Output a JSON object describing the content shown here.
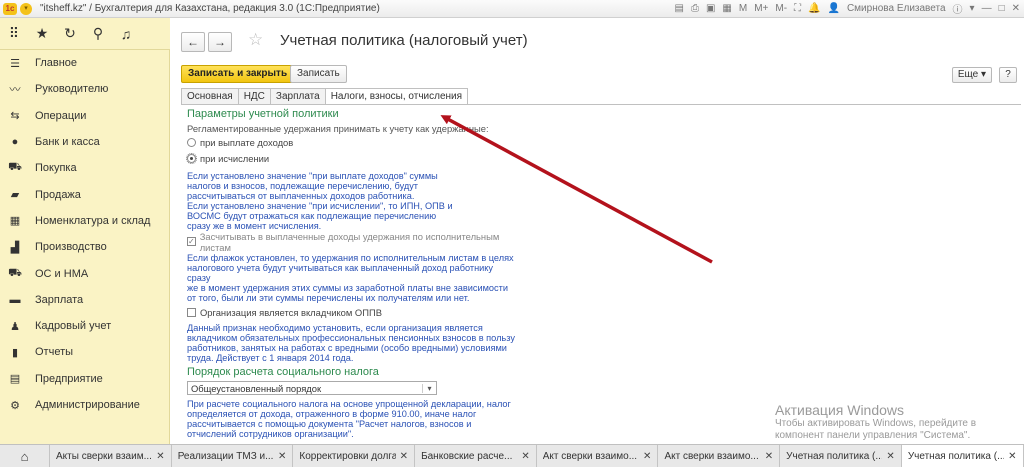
{
  "window": {
    "title": "\"itsheff.kz\" / Бухгалтерия для Казахстана, редакция 3.0  (1С:Предприятие)",
    "user": "Смирнова Елизавета"
  },
  "iconbar": [
    "apps-icon",
    "star-icon",
    "history-icon",
    "search-icon",
    "bell-icon"
  ],
  "sidebar": {
    "items": [
      {
        "label": "Главное",
        "icon": "menu-icon"
      },
      {
        "label": "Руководителю",
        "icon": "chart-icon"
      },
      {
        "label": "Операции",
        "icon": "operations-icon"
      },
      {
        "label": "Банк и касса",
        "icon": "bank-icon"
      },
      {
        "label": "Покупка",
        "icon": "cart-icon"
      },
      {
        "label": "Продажа",
        "icon": "bag-icon"
      },
      {
        "label": "Номенклатура и склад",
        "icon": "warehouse-icon"
      },
      {
        "label": "Производство",
        "icon": "factory-icon"
      },
      {
        "label": "ОС и НМА",
        "icon": "truck-icon"
      },
      {
        "label": "Зарплата",
        "icon": "salary-icon"
      },
      {
        "label": "Кадровый учет",
        "icon": "people-icon"
      },
      {
        "label": "Отчеты",
        "icon": "reports-icon"
      },
      {
        "label": "Предприятие",
        "icon": "enterprise-icon"
      },
      {
        "label": "Администрирование",
        "icon": "gear-icon"
      }
    ]
  },
  "form": {
    "title": "Учетная политика (налоговый учет)",
    "save_close": "Записать и закрыть",
    "save": "Записать",
    "more": "Еще ▾",
    "help": "?",
    "tabs": [
      "Основная",
      "НДС",
      "Зарплата",
      "Налоги, взносы, отчисления"
    ]
  },
  "content": {
    "section1": "Параметры учетной политики",
    "withhold_label": "Регламентированные удержания принимать к учету как удержанные:",
    "radio1": "при выплате доходов",
    "radio2": "при исчислении",
    "hint1": [
      "Если установлено значение \"при выплате доходов\" суммы",
      "налогов и взносов, подлежащие перечислению, будут",
      "рассчитываться от выплаченных доходов работника.",
      "Если установлено значение \"при исчислении\", то ИПН, ОПВ и",
      "ВОСМС будут отражаться как подлежащие перечислению",
      "сразу же в момент исчисления."
    ],
    "check1": "Засчитывать в выплаченные доходы удержания по исполнительным листам",
    "hint2": [
      "Если флажок установлен, то удержания по исполнительным листам в целях",
      "налогового учета будут учитываться как выплаченный доход работнику сразу",
      "же в момент удержания этих суммы из заработной платы вне зависимости",
      "от того, были ли эти суммы перечислены их получателям или нет."
    ],
    "check2": "Организация является вкладчиком ОППВ",
    "hint3": [
      "Данный признак необходимо установить, если организация является",
      "вкладчиком обязательных профессиональных пенсионных взносов в пользу",
      "работников, занятых на работах с вредными (особо вредными) условиями",
      "труда. Действует с 1 января 2014 года."
    ],
    "section2": "Порядок расчета социального налога",
    "select_value": "Общеустановленный порядок",
    "hint4": [
      "При расчете социального налога на основе упрощенной декларации, налог",
      "определяется от дохода, отраженного в форме 910.00, иначе налог",
      "рассчитывается с помощью документа \"Расчет налогов, взносов и",
      "отчислений сотрудников организации\"."
    ]
  },
  "activation": {
    "title": "Активация Windows",
    "line1": "Чтобы активировать Windows, перейдите в",
    "line2": "компонент панели управления \"Система\"."
  },
  "bottom_tabs": [
    {
      "label": "Акты сверки взаим..."
    },
    {
      "label": "Реализации ТМЗ и..."
    },
    {
      "label": "Корректировки долга"
    },
    {
      "label": "Банковские расче..."
    },
    {
      "label": "Акт сверки взаимо..."
    },
    {
      "label": "Акт сверки взаимо..."
    },
    {
      "label": "Учетная политика (..."
    },
    {
      "label": "Учетная политика (..."
    }
  ]
}
